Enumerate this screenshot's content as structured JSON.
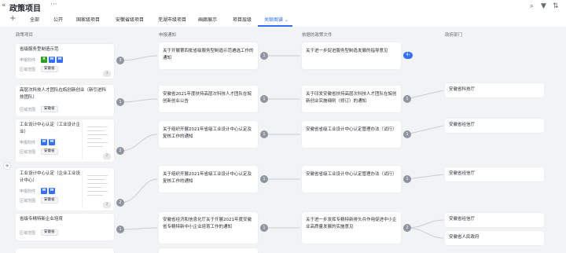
{
  "header": {
    "title": "政策项目",
    "more_glyph": "···"
  },
  "tabs": [
    {
      "label": "全部"
    },
    {
      "label": "公开"
    },
    {
      "label": "国家级项目"
    },
    {
      "label": "安徽省级项目"
    },
    {
      "label": "芜湖市级项目"
    },
    {
      "label": "画廊展示"
    },
    {
      "label": "项目层级"
    },
    {
      "label": "关联图谱",
      "active": true
    }
  ],
  "columns": [
    "政策项目",
    "申报通知",
    "依据的政策文件",
    "政府部门"
  ],
  "meta": {
    "attachment_label": "申报附件",
    "region_label": "区域范围"
  },
  "projects": [
    {
      "title": "省级服务型制造示范",
      "region": "安徽省",
      "files": [
        "X",
        "W",
        "W"
      ],
      "badge": "3"
    },
    {
      "title": "高层次科技人才团队在皖创新创业（新引进科技团队）",
      "region": "安徽省",
      "badge": "1"
    },
    {
      "title": "工业设计中心认定（工业设计企业）",
      "region": "安徽省",
      "files": [
        "W",
        "W"
      ],
      "badge": "2"
    },
    {
      "title": "工业设计中心认定（企业工业设计中心）",
      "region": "安徽省",
      "files": [
        "W",
        "W"
      ],
      "badge": "2"
    },
    {
      "title": "省级专精特新企业培育",
      "region": "安徽省",
      "badge": "1"
    }
  ],
  "notices": [
    {
      "title": "关于开展第四批省级服务型制造示范遴选工作的通知",
      "badge": "1"
    },
    {
      "title": "安徽省2021年度扶持高层次科技人才团队在皖创新创业公告",
      "badge": "1"
    },
    {
      "title": "关于组织开展2021年省级工业设计中心认定及复核工作的通知",
      "badge": "1"
    },
    {
      "title": "关于组织开展2021年省级工业设计中心认定及复核工作的通知",
      "badge": "1"
    },
    {
      "title": "安徽省经济和信息化厅关于开展2021年度安徽省专精特新中小企业培育工作的通知",
      "badge": "1"
    }
  ],
  "policies": [
    {
      "title": "关于进一步促进服务型制造发展的指导意见",
      "badge": "4"
    },
    {
      "title": "关于印发安徽省扶持高层次科技人才团队在皖创新创业实施细则（修订）的通知",
      "badge": "1"
    },
    {
      "title": "安徽省省级工业设计中心认定管理办法（试行）",
      "badge": "1"
    },
    {
      "title": "安徽省省级工业设计中心认定管理办法（试行）",
      "badge": "1"
    },
    {
      "title": "关于进一步发挥专精特新排头兵作用促进中小企业高质量发展的实施意见",
      "badge": "2"
    }
  ],
  "departments": [
    {
      "name": "安徽省科技厅"
    },
    {
      "name": "安徽省经信厅"
    },
    {
      "name": "安徽省经信厅"
    },
    {
      "name": "安徽省经信厅"
    },
    {
      "name": "安徽省人民政府"
    }
  ],
  "colors": {
    "accent": "#3370ff",
    "excel": "#2ea121",
    "badge": "#8f959e"
  }
}
